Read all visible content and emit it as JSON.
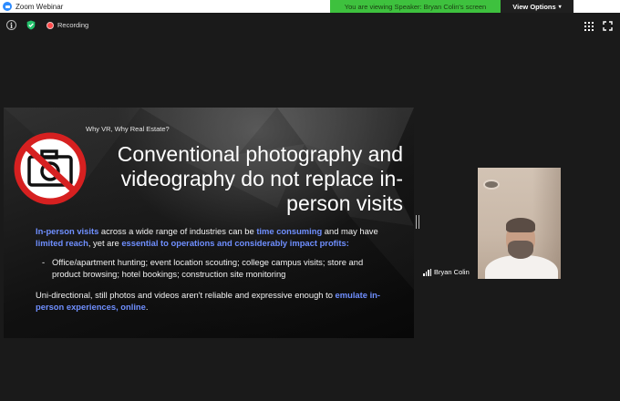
{
  "window": {
    "title": "Zoom Webinar",
    "share_banner": "You are viewing Speaker: Bryan Colin's screen",
    "view_options_label": "View Options"
  },
  "toolbar": {
    "recording_label": "Recording",
    "info_icon": "info-icon",
    "security_icon": "shield-check-icon",
    "gallery_icon": "grid-icon",
    "fullscreen_icon": "fullscreen-icon"
  },
  "slide": {
    "heading": "Why VR, Why Real Estate?",
    "title": "Conventional photography and videography do not replace in-person visits",
    "p1": [
      {
        "text": "In-person visits",
        "hl": true
      },
      {
        "text": " across a wide range of industries can be ",
        "hl": false
      },
      {
        "text": "time consuming",
        "hl": true
      },
      {
        "text": " and may have ",
        "hl": false
      },
      {
        "text": "limited reach",
        "hl": true
      },
      {
        "text": ", yet are ",
        "hl": false
      },
      {
        "text": "essential to operations and considerably impact profits:",
        "hl": true
      }
    ],
    "bullet": "Office/apartment hunting; event location scouting; college campus visits; store and product browsing; hotel bookings; construction site monitoring",
    "p2": [
      {
        "text": "Uni-directional, still photos and videos aren't reliable and expressive enough to ",
        "hl": false
      },
      {
        "text": "emulate in-person experiences, online",
        "hl": true
      },
      {
        "text": ".",
        "hl": false
      }
    ],
    "icon": "no-camera-icon"
  },
  "speaker": {
    "name": "Bryan Colin"
  },
  "colors": {
    "accent_highlight": "#6f8fff",
    "banner_green": "#3ec13e",
    "recording_red": "#ff4a4a"
  }
}
